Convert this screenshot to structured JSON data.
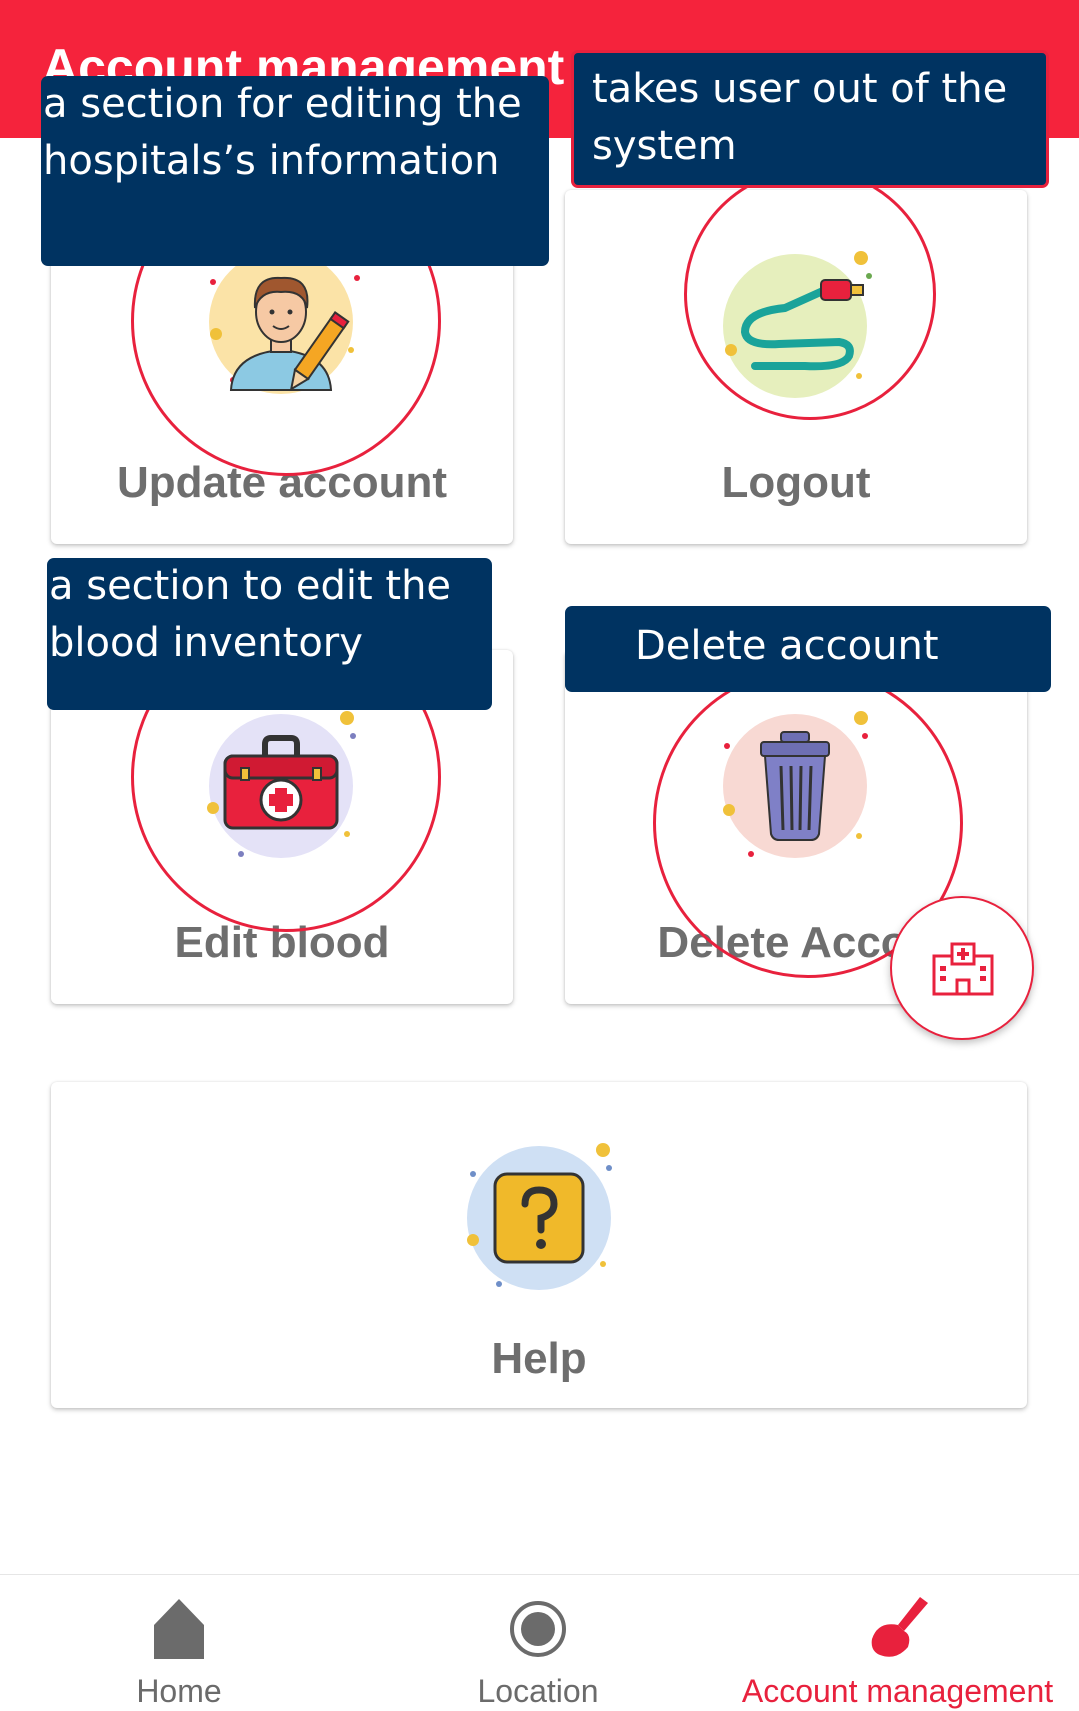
{
  "appbar": {
    "title": "Account management"
  },
  "cards": {
    "update_account": {
      "label": "Update account",
      "icon": "user-edit-icon"
    },
    "logout": {
      "label": "Logout",
      "icon": "cable-plug-icon"
    },
    "edit_blood": {
      "label": "Edit blood",
      "icon": "medical-kit-icon"
    },
    "delete_account": {
      "label": "Delete Accou",
      "icon": "trash-can-icon"
    },
    "help": {
      "label": "Help",
      "icon": "question-icon"
    }
  },
  "annotations": {
    "update": "a  section for editing the hospitals’s information",
    "logout": "takes user out of the system",
    "edit_blood": "a section to edit the blood inventory",
    "delete": "Delete account"
  },
  "fab": {
    "icon": "hospital-icon"
  },
  "bottom_nav": {
    "items": [
      {
        "label": "Home",
        "icon": "home-icon"
      },
      {
        "label": "Location",
        "icon": "location-target-icon"
      },
      {
        "label": "Account management",
        "icon": "account-brush-icon"
      }
    ],
    "active_index": 2
  },
  "colors": {
    "accent": "#f5233c",
    "annotation_bg": "#003361",
    "label_gray": "#6e6e6e"
  }
}
